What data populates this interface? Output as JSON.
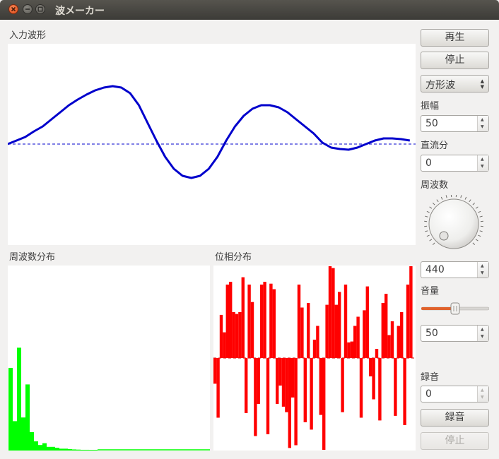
{
  "window": {
    "title": "波メーカー"
  },
  "labels": {
    "input_waveform": "入力波形",
    "freq_distribution": "周波数分布",
    "phase_distribution": "位相分布"
  },
  "controls": {
    "play": "再生",
    "stop": "停止",
    "wave_type": "方形波",
    "amplitude_label": "振幅",
    "amplitude_value": "50",
    "dc_label": "直流分",
    "dc_value": "0",
    "frequency_label": "周波数",
    "frequency_value": "440",
    "volume_label": "音量",
    "volume_value": "50",
    "volume_level": 0.5,
    "record_label": "録音",
    "record_value": "0",
    "record_button": "録音",
    "record_stop": "停止"
  },
  "colors": {
    "waveform": "#0000cc",
    "spectrum": "#00ff00",
    "phase": "#ff0000",
    "slider_fill": "#e0622c"
  },
  "plots": {
    "waveform_shape": [
      [
        0,
        0
      ],
      [
        3,
        0.05
      ],
      [
        6,
        0.1
      ],
      [
        9,
        0.18
      ],
      [
        12,
        0.25
      ],
      [
        15,
        0.35
      ],
      [
        18,
        0.45
      ],
      [
        21,
        0.55
      ],
      [
        24,
        0.63
      ],
      [
        27,
        0.7
      ],
      [
        30,
        0.76
      ],
      [
        33,
        0.8
      ],
      [
        36,
        0.82
      ],
      [
        39,
        0.8
      ],
      [
        42,
        0.72
      ],
      [
        45,
        0.55
      ],
      [
        48,
        0.3
      ],
      [
        51,
        0.05
      ],
      [
        54,
        -0.18
      ],
      [
        57,
        -0.35
      ],
      [
        60,
        -0.45
      ],
      [
        63,
        -0.48
      ],
      [
        66,
        -0.45
      ],
      [
        69,
        -0.35
      ],
      [
        72,
        -0.18
      ],
      [
        75,
        0.05
      ],
      [
        78,
        0.25
      ],
      [
        81,
        0.4
      ],
      [
        84,
        0.5
      ],
      [
        87,
        0.55
      ],
      [
        90,
        0.55
      ],
      [
        93,
        0.52
      ],
      [
        96,
        0.45
      ],
      [
        99,
        0.35
      ],
      [
        102,
        0.25
      ],
      [
        105,
        0.15
      ],
      [
        108,
        0.02
      ],
      [
        111,
        -0.05
      ],
      [
        114,
        -0.07
      ],
      [
        117,
        -0.08
      ],
      [
        120,
        -0.05
      ],
      [
        123,
        0
      ],
      [
        126,
        0.05
      ],
      [
        129,
        0.08
      ],
      [
        132,
        0.08
      ],
      [
        135,
        0.07
      ],
      [
        138,
        0.05
      ]
    ],
    "spectrum": [
      0.45,
      0.16,
      0.56,
      0.18,
      0.36,
      0.1,
      0.05,
      0.03,
      0.04,
      0.02,
      0.02,
      0.015,
      0.01,
      0.01,
      0.008,
      0.006,
      0.005,
      0.004,
      0.004,
      0.003,
      0.003
    ],
    "phase": [
      -0.28,
      -0.65,
      0.47,
      0.28,
      0.8,
      0.83,
      0.5,
      0.48,
      0.5,
      0.88,
      -0.6,
      0.8,
      0.61,
      -0.85,
      -0.5,
      0.8,
      0.83,
      -0.83,
      0.81,
      0.75,
      -0.5,
      -0.3,
      -0.53,
      -0.59,
      -0.98,
      -0.43,
      -0.95,
      0.8,
      0.55,
      -0.7,
      0.6,
      -0.78,
      0.2,
      0.35,
      -0.62,
      -1,
      0.58,
      1,
      0.98,
      0.58,
      0.72,
      -0.59,
      0.8,
      0.17,
      0.18,
      0.35,
      0.45,
      -0.65,
      0.52,
      0.78,
      -0.2,
      -0.45,
      0.1,
      -0.68,
      0.6,
      0.7,
      0.25,
      0.4,
      -0.63,
      0.35,
      0.5,
      -0.73,
      0.8,
      1
    ]
  }
}
